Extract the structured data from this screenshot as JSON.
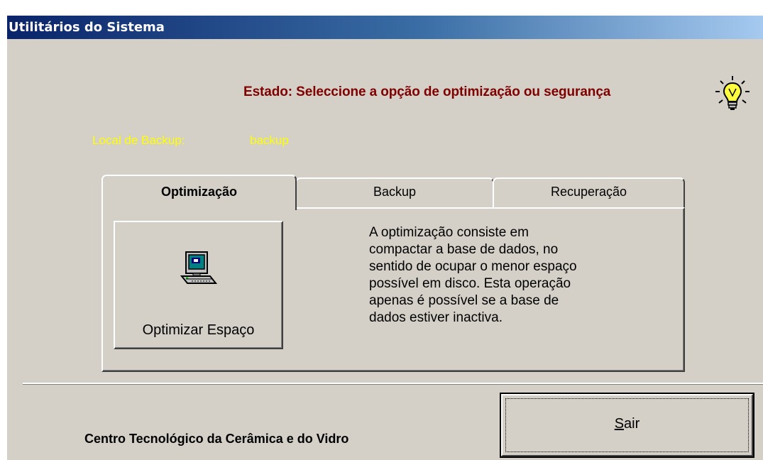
{
  "window": {
    "title": "Utilitários do Sistema"
  },
  "status": {
    "text": "Estado: Seleccione a opção de optimização ou segurança",
    "icon": "lightbulb-icon"
  },
  "backup": {
    "label": "Local de Backup:",
    "value": "backup"
  },
  "tabs": [
    {
      "label": "Optimização",
      "active": true
    },
    {
      "label": "Backup",
      "active": false
    },
    {
      "label": "Recuperação",
      "active": false
    }
  ],
  "optimization": {
    "button_label": "Optimizar Espaço",
    "button_icon": "computer-icon",
    "description": "A optimização consiste em\ncompactar a base de dados, no\nsentido de ocupar o menor espaço\npossível em disco. Esta operação\napenas é possível se a base de\ndados estiver inactiva."
  },
  "footer": {
    "organization": "Centro Tecnológico da Cerâmica e do Vidro",
    "exit_access_key": "S",
    "exit_label_rest": "air"
  },
  "colors": {
    "window_bg": "#d4d0c8",
    "title_gradient_start": "#0a246a",
    "title_gradient_end": "#a6caf0",
    "status_text": "#800000",
    "backup_text": "#ffff00"
  }
}
